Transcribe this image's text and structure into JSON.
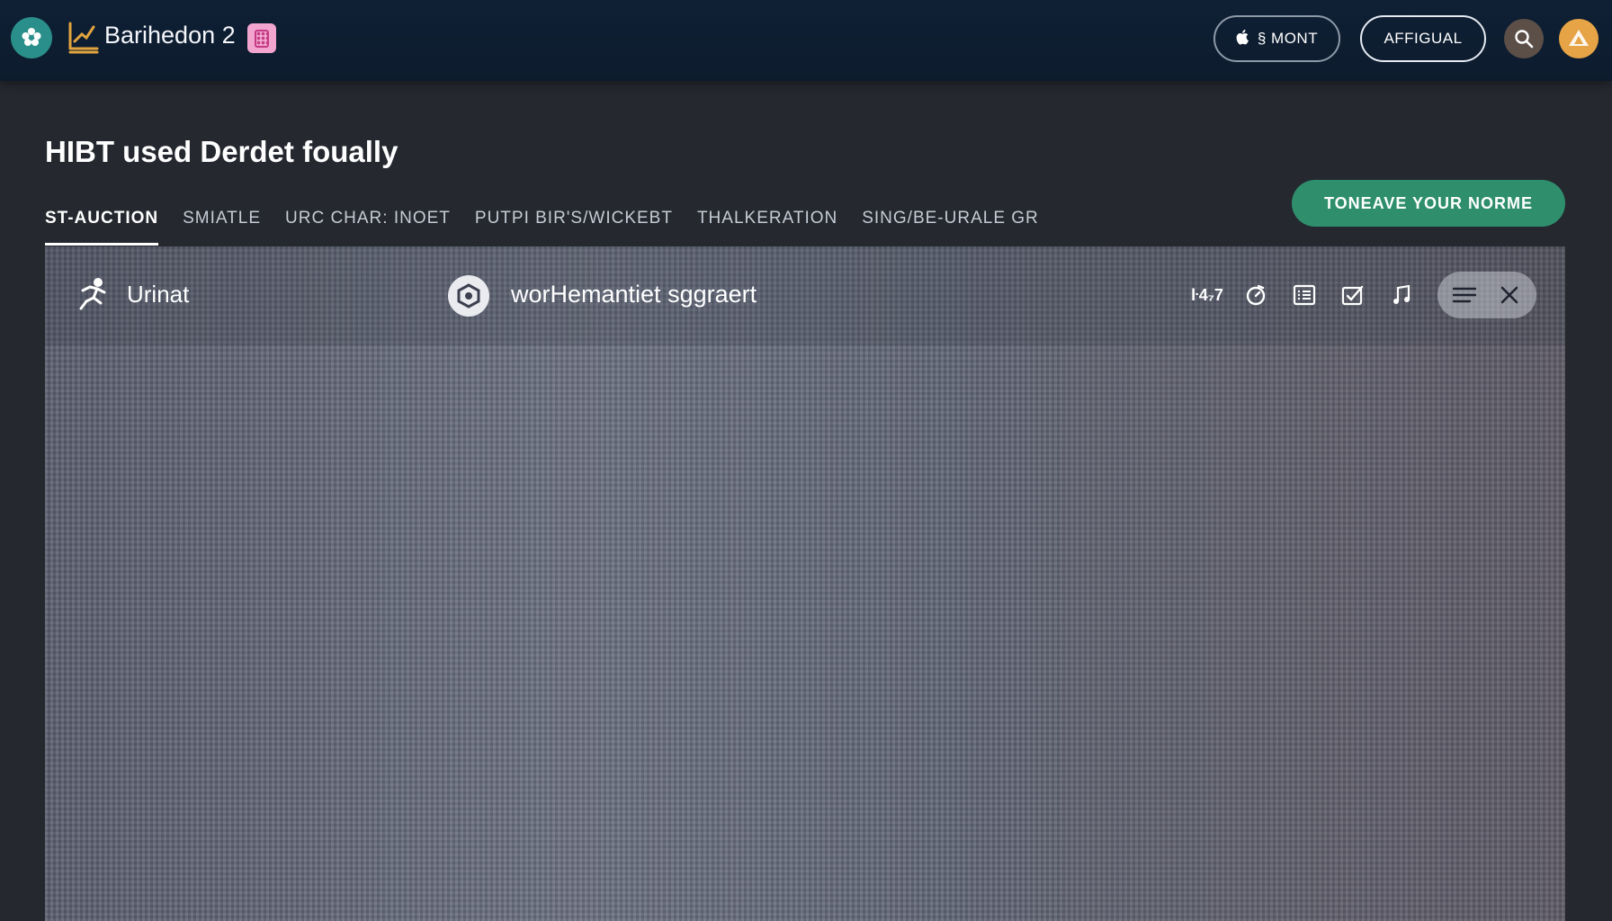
{
  "header": {
    "brand_title": "Barihedon 2",
    "login_label": "§ MONT",
    "signup_label": "AFFIGUAL",
    "icons": {
      "logo": "flower-icon",
      "brand": "chart-icon",
      "badge": "document-icon",
      "apple": "apple-icon",
      "search": "search-icon",
      "avatar": "avatar-icon"
    }
  },
  "page": {
    "title_bold": "HIBT",
    "title_mid": "used",
    "title_bold2": "Derdet",
    "title_end": "foually",
    "tabs": [
      {
        "label": "ST-AUCTION",
        "active": true
      },
      {
        "label": "SMIATLE",
        "active": false
      },
      {
        "label": "URC CHAR: INOET",
        "active": false
      },
      {
        "label": "PUTPI BIR'S/WICKEBT",
        "active": false
      },
      {
        "label": "THALKERATION",
        "active": false
      },
      {
        "label": "SING/BE-URALE GR",
        "active": false
      }
    ],
    "cta_label": "TONEAVE YOUR NORME"
  },
  "viewer": {
    "left_label": "Urinat",
    "center_label": "worHemantiet sggraert",
    "tool_label": "ŀ4₇7",
    "tools": [
      "timer-icon",
      "list-icon",
      "edit-icon",
      "music-icon"
    ],
    "menu_icon": "menu-icon",
    "close_icon": "close-icon"
  },
  "colors": {
    "topbar": "#0f2035",
    "background": "#25282f",
    "accent_green": "#2f8f6d",
    "logo_teal": "#2a8f8a",
    "avatar_orange": "#e7a446",
    "badge_pink": "#f2a6cf"
  }
}
